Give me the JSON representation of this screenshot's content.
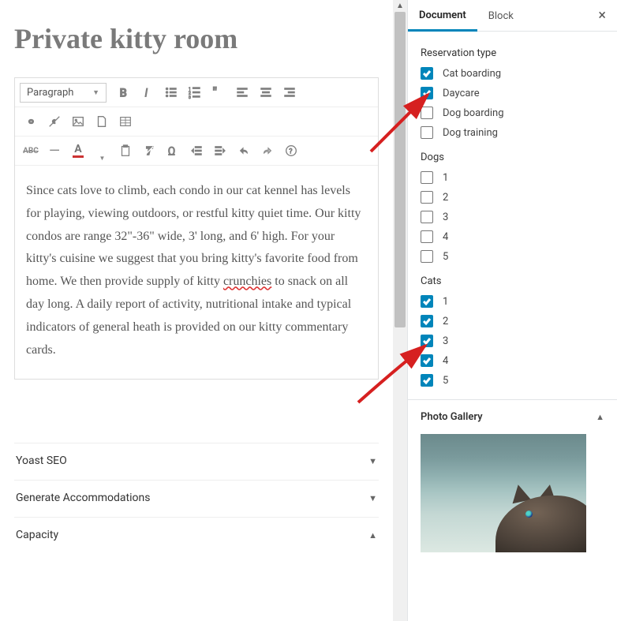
{
  "title": "Private kitty room",
  "editor": {
    "format_label": "Paragraph",
    "content_before": "Since cats love to climb, each condo in our cat kennel has levels for playing, viewing outdoors, or restful kitty quiet time. Our kitty condos are range 32\"-36\" wide, 3' long, and 6' high. For your kitty's cuisine we suggest that you bring kitty's favorite food from home. We then provide supply of kitty ",
    "squiggle_word": "crunchies",
    "content_after": " to snack on all day long. A daily report of activity, nutritional intake and typical indicators of general heath is provided on our kitty commentary cards."
  },
  "panels": {
    "yoast": "Yoast SEO",
    "generate": "Generate Accommodations",
    "capacity": "Capacity"
  },
  "sidebar": {
    "tabs": {
      "document": "Document",
      "block": "Block"
    },
    "sections": {
      "reservation": {
        "label": "Reservation type",
        "items": [
          {
            "label": "Cat boarding",
            "checked": true
          },
          {
            "label": "Daycare",
            "checked": true
          },
          {
            "label": "Dog boarding",
            "checked": false
          },
          {
            "label": "Dog training",
            "checked": false
          }
        ]
      },
      "dogs": {
        "label": "Dogs",
        "items": [
          {
            "label": "1",
            "checked": false
          },
          {
            "label": "2",
            "checked": false
          },
          {
            "label": "3",
            "checked": false
          },
          {
            "label": "4",
            "checked": false
          },
          {
            "label": "5",
            "checked": false
          }
        ]
      },
      "cats": {
        "label": "Cats",
        "items": [
          {
            "label": "1",
            "checked": true
          },
          {
            "label": "2",
            "checked": true
          },
          {
            "label": "3",
            "checked": true
          },
          {
            "label": "4",
            "checked": true
          },
          {
            "label": "5",
            "checked": true
          }
        ]
      }
    },
    "gallery_label": "Photo Gallery"
  }
}
